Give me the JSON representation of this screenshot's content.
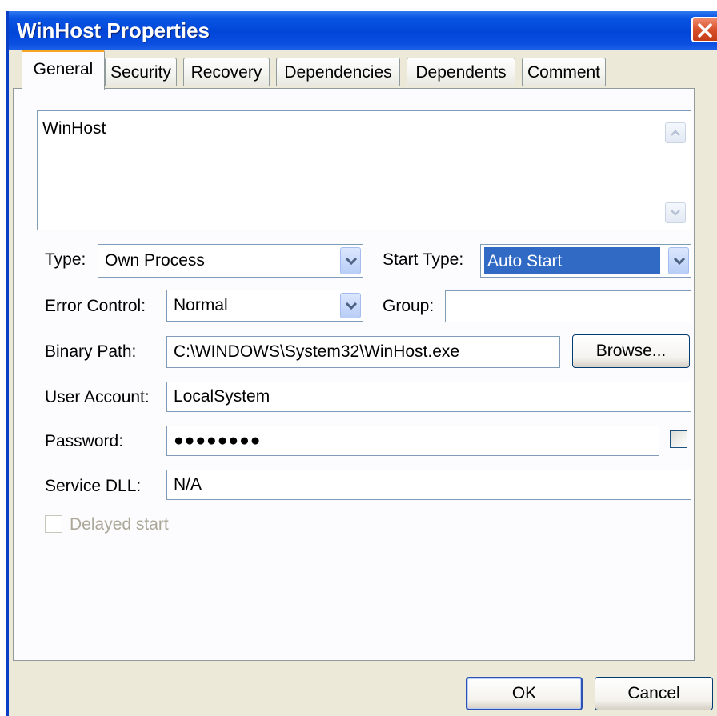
{
  "window": {
    "title": "WinHost Properties"
  },
  "tabs": [
    {
      "label": "General",
      "active": true
    },
    {
      "label": "Security",
      "active": false
    },
    {
      "label": "Recovery",
      "active": false
    },
    {
      "label": "Dependencies",
      "active": false
    },
    {
      "label": "Dependents",
      "active": false
    },
    {
      "label": "Comment",
      "active": false
    }
  ],
  "description": {
    "value": "WinHost"
  },
  "form": {
    "type_label": "Type:",
    "type_value": "Own Process",
    "start_type_label": "Start Type:",
    "start_type_value": "Auto Start",
    "error_control_label": "Error Control:",
    "error_control_value": "Normal",
    "group_label": "Group:",
    "group_value": "",
    "binary_path_label": "Binary Path:",
    "binary_path_value": "C:\\WINDOWS\\System32\\WinHost.exe",
    "browse_label": "Browse...",
    "user_account_label": "User Account:",
    "user_account_value": "LocalSystem",
    "password_label": "Password:",
    "password_value": "●●●●●●●●",
    "service_dll_label": "Service DLL:",
    "service_dll_value": "N/A",
    "delayed_start_label": "Delayed start"
  },
  "footer": {
    "ok_label": "OK",
    "cancel_label": "Cancel"
  },
  "colors": {
    "titlebar": "#0046d8",
    "selection": "#316ac5",
    "active_tab_accent": "#f5a623",
    "close_button": "#d8512b",
    "dialog_background": "#ece9d8"
  },
  "icons": {
    "close": "close-icon",
    "dropdown": "chevron-down-icon",
    "scroll_up": "scroll-up-icon",
    "scroll_down": "scroll-down-icon"
  }
}
